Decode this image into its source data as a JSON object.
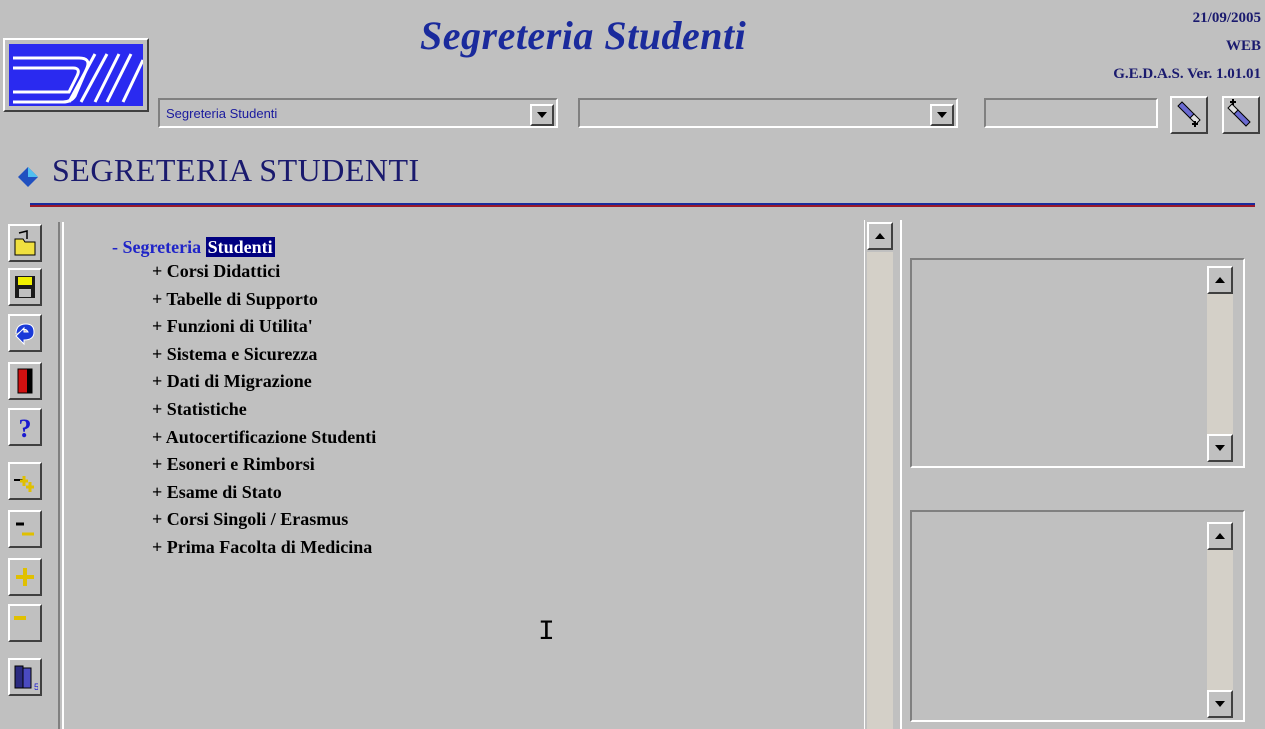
{
  "header": {
    "app_title": "Segreteria Studenti",
    "date": "21/09/2005",
    "mode": "WEB",
    "version": "G.E.D.A.S. Ver. 1.01.01"
  },
  "toolbar": {
    "combo1_value": "Segreteria Studenti",
    "combo2_value": "",
    "search_value": ""
  },
  "page": {
    "heading": "SEGRETERIA STUDENTI"
  },
  "tree": {
    "root_prefix": "- Segreteria",
    "root_selected": "Studenti",
    "items": [
      "+ Corsi Didattici",
      "+ Tabelle di Supporto",
      "+ Funzioni di Utilita'",
      "+ Sistema e Sicurezza",
      "+ Dati di Migrazione",
      "+ Statistiche",
      "+ Autocertificazione Studenti",
      "+ Esoneri e Rimborsi",
      "+ Esame di Stato",
      "+ Corsi Singoli / Erasmus",
      "+ Prima Facolta di Medicina"
    ]
  },
  "side_toolbar_icons": [
    "open-folder-icon",
    "save-disk-icon",
    "undo-icon",
    "exit-door-icon",
    "help-question-icon",
    "expand-tree-icon",
    "collapse-tree-icon",
    "plus-icon",
    "minus-icon",
    "books-icon"
  ],
  "colors": {
    "title_blue": "#1a2a9c",
    "selection": "#000080",
    "background": "#c0c0c0"
  }
}
